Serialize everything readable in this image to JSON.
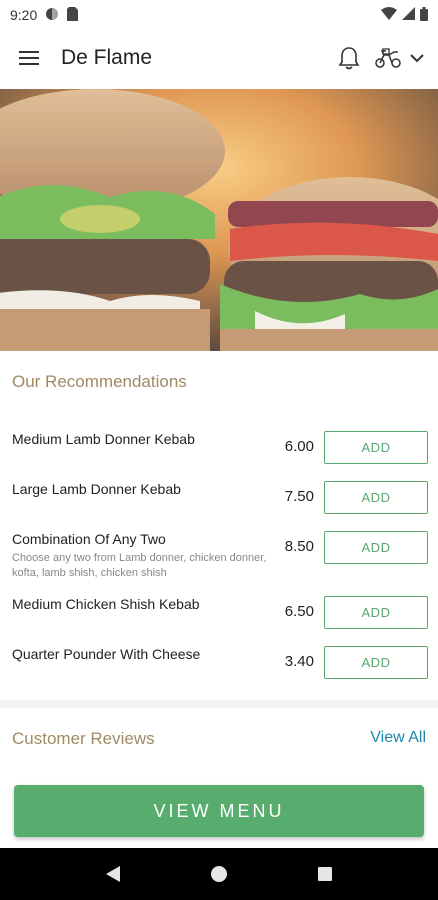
{
  "status_bar": {
    "time": "9:20"
  },
  "app_bar": {
    "title": "De Flame"
  },
  "recommendations": {
    "title": "Our Recommendations",
    "items": [
      {
        "name": "Medium Lamb Donner Kebab",
        "description": "",
        "price": "6.00",
        "button": "ADD"
      },
      {
        "name": "Large Lamb Donner Kebab",
        "description": "",
        "price": "7.50",
        "button": "ADD"
      },
      {
        "name": "Combination Of Any Two",
        "description": "Choose any two from Lamb donner, chicken donner, kofta, lamb shish, chicken shish",
        "price": "8.50",
        "button": "ADD"
      },
      {
        "name": "Medium Chicken Shish Kebab",
        "description": "",
        "price": "6.50",
        "button": "ADD"
      },
      {
        "name": "Quarter Pounder With Cheese",
        "description": "",
        "price": "3.40",
        "button": "ADD"
      }
    ]
  },
  "reviews": {
    "title": "Customer Reviews",
    "view_all": "View All"
  },
  "footer": {
    "view_menu": "VIEW MENU"
  },
  "colors": {
    "accent_green": "#58ac6d",
    "section_title": "#a08a63",
    "link_blue": "#1e88a8"
  }
}
